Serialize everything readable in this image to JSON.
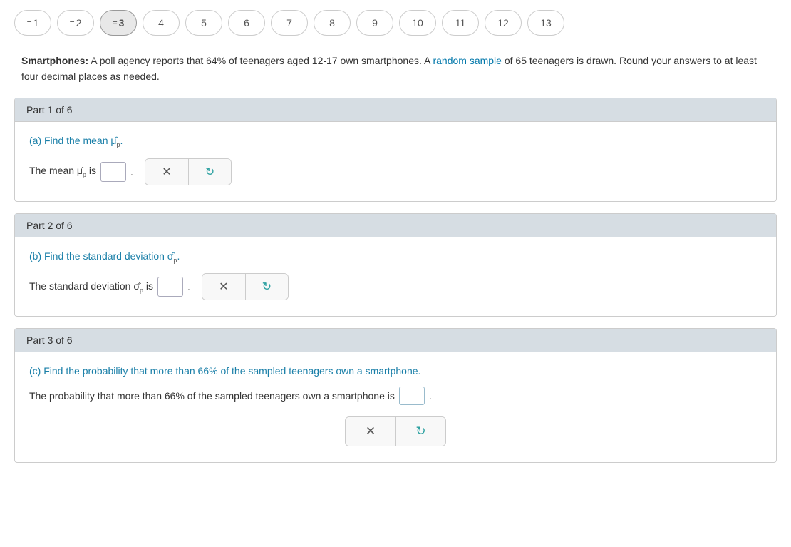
{
  "nav": {
    "tabs": [
      {
        "label": "1",
        "prefix": "=",
        "state": "completed"
      },
      {
        "label": "2",
        "prefix": "=",
        "state": "completed"
      },
      {
        "label": "3",
        "prefix": "=",
        "state": "active"
      },
      {
        "label": "4",
        "prefix": "",
        "state": "normal"
      },
      {
        "label": "5",
        "prefix": "",
        "state": "normal"
      },
      {
        "label": "6",
        "prefix": "",
        "state": "normal"
      },
      {
        "label": "7",
        "prefix": "",
        "state": "normal"
      },
      {
        "label": "8",
        "prefix": "",
        "state": "normal"
      },
      {
        "label": "9",
        "prefix": "",
        "state": "normal"
      },
      {
        "label": "10",
        "prefix": "",
        "state": "normal"
      },
      {
        "label": "11",
        "prefix": "",
        "state": "normal"
      },
      {
        "label": "12",
        "prefix": "",
        "state": "normal"
      },
      {
        "label": "13",
        "prefix": "",
        "state": "normal"
      }
    ]
  },
  "problem": {
    "bold_label": "Smartphones:",
    "text": " A poll agency reports that 64% of teenagers aged 12-17 own smartphones. A random sample of 65 teenagers is drawn. Round your answers to at least four decimal places as needed."
  },
  "parts": [
    {
      "header": "Part 1 of 6",
      "question": "(a) Find the mean μ̂.",
      "answer_prefix": "The mean μ̂ is",
      "answer_suffix": ".",
      "input_name": "mean-input"
    },
    {
      "header": "Part 2 of 6",
      "question": "(b) Find the standard deviation σ̂.",
      "answer_prefix": "The standard deviation σ̂ is",
      "answer_suffix": ".",
      "input_name": "std-dev-input"
    },
    {
      "header": "Part 3 of 6",
      "question": "(c) Find the probability that more than 66% of the sampled teenagers own a smartphone.",
      "answer_prefix": "The probability that more than 66% of the sampled teenagers own a smartphone is",
      "answer_suffix": ".",
      "input_name": "prob-input"
    }
  ],
  "buttons": {
    "clear_label": "×",
    "reset_label": "↺"
  }
}
